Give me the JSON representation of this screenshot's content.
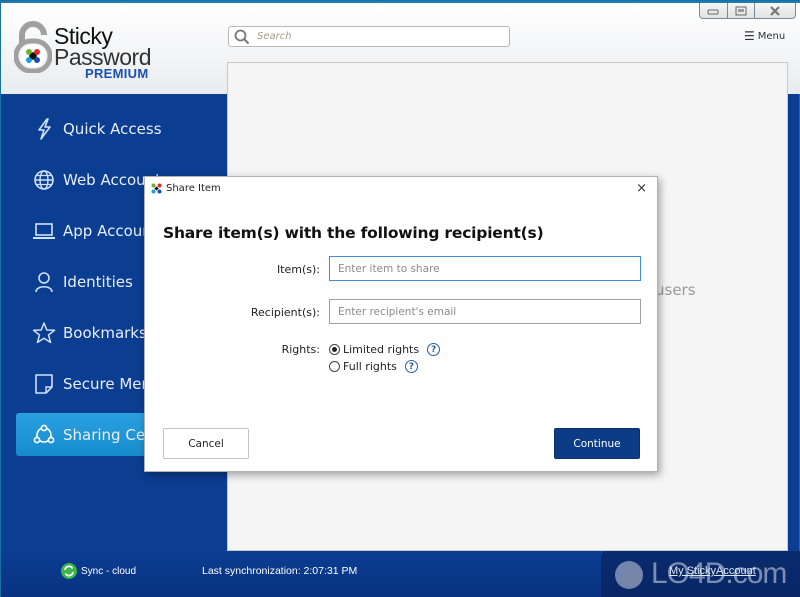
{
  "app": {
    "logo": {
      "line1": "Sticky",
      "line2": "Password",
      "line3": "PREMIUM"
    },
    "search": {
      "placeholder": "Search",
      "value": ""
    },
    "window_controls": {
      "minimize": "minimize",
      "restore": "restore",
      "close": "close"
    },
    "menu_label": "Menu",
    "colors": {
      "sidebar_bg": "#0b3d91",
      "active_item": "#1f95d6",
      "primary_button": "#0c3c85"
    }
  },
  "sidebar": {
    "items": [
      {
        "label": "Quick Access",
        "icon": "lightning-icon",
        "active": false
      },
      {
        "label": "Web Accounts",
        "icon": "globe-icon",
        "active": false
      },
      {
        "label": "App Accounts",
        "icon": "laptop-icon",
        "active": false
      },
      {
        "label": "Identities",
        "icon": "person-icon",
        "active": false
      },
      {
        "label": "Bookmarks",
        "icon": "star-icon",
        "active": false
      },
      {
        "label": "Secure Memos",
        "icon": "memo-icon",
        "active": false
      },
      {
        "label": "Sharing Center",
        "icon": "sharing-icon",
        "active": true
      }
    ]
  },
  "content": {
    "partial_text": "users"
  },
  "footer": {
    "sync_label": "Sync - cloud",
    "last_sync": "Last synchronization: 2:07:31 PM",
    "account_link": "My StickyAccount",
    "watermark": "LO4D.com"
  },
  "dialog": {
    "title": "Share Item",
    "heading": "Share item(s) with the following recipient(s)",
    "items_label": "Item(s):",
    "items_placeholder": "Enter item to share",
    "items_value": "",
    "recipients_label": "Recipient(s):",
    "recipients_placeholder": "Enter recipient's email",
    "recipients_value": "",
    "rights_label": "Rights:",
    "rights_options": [
      {
        "label": "Limited rights",
        "selected": true
      },
      {
        "label": "Full rights",
        "selected": false
      }
    ],
    "help_glyph": "?",
    "close_glyph": "×",
    "cancel_label": "Cancel",
    "continue_label": "Continue"
  }
}
